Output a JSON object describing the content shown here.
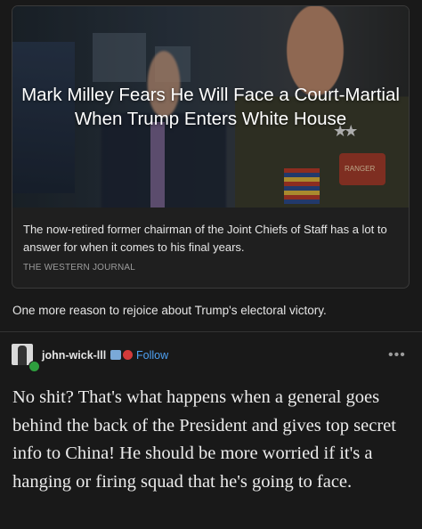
{
  "link_card": {
    "headline": "Mark Milley Fears He Will Face a Court-Martial When Trump Enters White House",
    "summary": "The now-retired former chairman of the Joint Chiefs of Staff has a lot to answer for when it comes to his final years.",
    "source": "THE WESTERN JOURNAL",
    "image_patch_text": "RANGER"
  },
  "caption": "One more reason to rejoice about Trump's electoral victory.",
  "reply": {
    "username": "john-wick-lll",
    "follow_label": "Follow",
    "more_label": "•••",
    "text": "No shit?  That's what happens when a general goes behind the back of the President and gives top secret info to China! He should be more worried if it's a hanging or firing squad that he's going to face."
  },
  "colors": {
    "background": "#191919",
    "link": "#4ea1f3"
  }
}
